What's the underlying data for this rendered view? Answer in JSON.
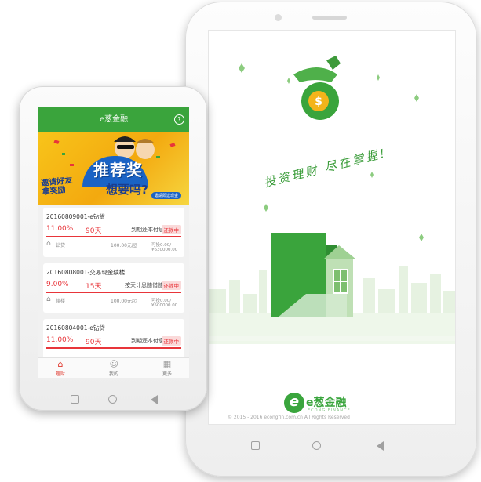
{
  "left_app": {
    "title": "e葱金融",
    "banner": {
      "headline": "推荐奖",
      "line1": "邀请好友",
      "line2": "拿奖励",
      "question": "想要吗?",
      "pill": "邀请即送现金"
    },
    "cards": [
      {
        "title": "20160809001-e钻贷",
        "rate": "11.00%",
        "term": "90天",
        "desc": "到期还本付息",
        "badge": "还款中",
        "type": "钻贷",
        "min": "100.00元起",
        "avail": "可投0.00/¥630000.00",
        "progress": 1.0
      },
      {
        "title": "20160808001-交易现金续楼",
        "rate": "9.00%",
        "term": "15天",
        "desc": "按天计息随借随还",
        "badge": "还款中",
        "type": "续楼",
        "min": "100.00元起",
        "avail": "可投0.00/¥500000.00",
        "progress": 1.0
      },
      {
        "title": "20160804001-e钻贷",
        "rate": "11.00%",
        "term": "90天",
        "desc": "到期还本付息",
        "badge": "还款中",
        "type": "",
        "min": "",
        "avail": "",
        "progress": 1.0
      }
    ],
    "tabs": [
      {
        "label": "理财",
        "icon": "home-icon",
        "active": true
      },
      {
        "label": "我的",
        "icon": "user-icon",
        "active": false
      },
      {
        "label": "更多",
        "icon": "grid-icon",
        "active": false
      }
    ]
  },
  "right_app": {
    "slogan": "投资理财 尽在掌握!",
    "logo_name": "e葱金融",
    "logo_sub": "ECONG FINANCE",
    "copyright": "© 2015 - 2016  econgfin.com.cn All Rights Reserved"
  },
  "colors": {
    "brand_green": "#3aa43c",
    "accent_red": "#e8353a"
  }
}
